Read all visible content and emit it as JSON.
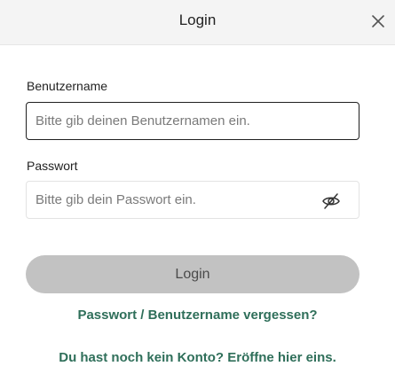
{
  "header": {
    "title": "Login"
  },
  "form": {
    "username": {
      "label": "Benutzername",
      "value": "",
      "placeholder": "Bitte gib deinen Benutzernamen ein."
    },
    "password": {
      "label": "Passwort",
      "value": "",
      "placeholder": "Bitte gib dein Passwort ein.",
      "visibility_icon": "eye-slash-icon"
    },
    "submit_label": "Login"
  },
  "links": {
    "forgot": "Passwort / Benutzername vergessen?",
    "register": "Du hast noch kein Konto? Eröffne hier eins."
  },
  "colors": {
    "header_bg": "#f4f4f4",
    "button_disabled_bg": "#c2c2c2",
    "link": "#2f6f5a",
    "focus_border": "#1f1f1f"
  }
}
